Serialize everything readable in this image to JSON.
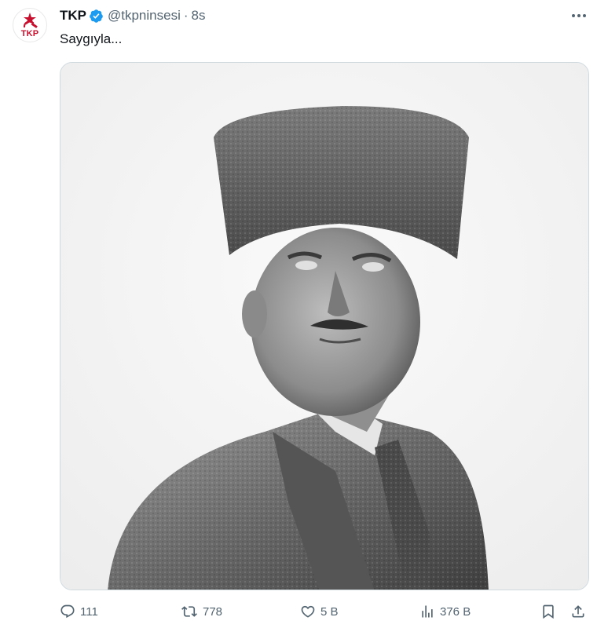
{
  "post": {
    "avatar_text": "TKP",
    "display_name": "TKP",
    "handle": "@tkpninsesi",
    "separator": "·",
    "time": "8s",
    "text": "Saygıyla...",
    "verified": true
  },
  "metrics": {
    "replies": "111",
    "reposts": "778",
    "likes": "5 B",
    "views": "376 B"
  },
  "icons": {
    "avatar": "tkp-logo-icon",
    "verified": "verified-badge-icon",
    "more": "more-dots-icon",
    "reply": "reply-icon",
    "repost": "repost-icon",
    "like": "heart-icon",
    "views": "views-bar-chart-icon",
    "bookmark": "bookmark-icon",
    "share": "share-icon"
  },
  "colors": {
    "text": "#0f1419",
    "secondary": "#536471",
    "verified": "#1d9bf0",
    "logo_red": "#c8102e",
    "border": "#cfd9de"
  }
}
